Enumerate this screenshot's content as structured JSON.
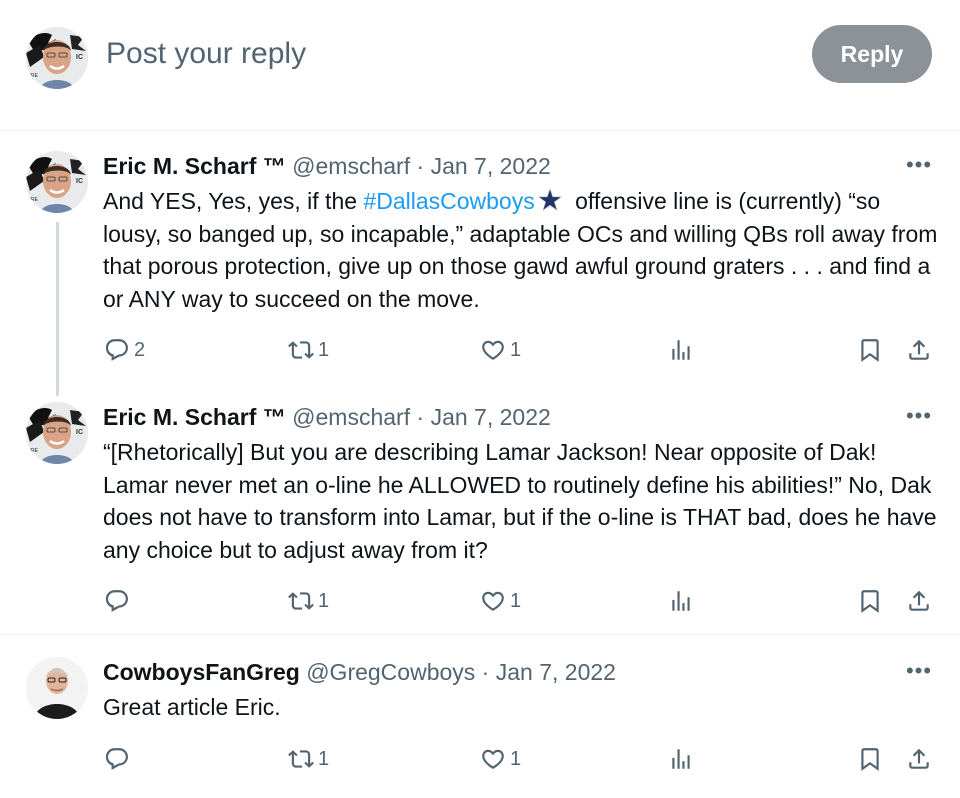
{
  "compose": {
    "placeholder": "Post your reply",
    "reply_label": "Reply"
  },
  "colors": {
    "link": "#1d9bf0",
    "muted": "#536471",
    "reply_button_disabled": "#8b9298"
  },
  "tweets": [
    {
      "name": "Eric M. Scharf ™",
      "handle": "@emscharf",
      "separator": "·",
      "date": "Jan 7, 2022",
      "text_before": "And YES, Yes, yes, if the ",
      "hashtag": "#DallasCowboys",
      "text_after": " offensive line is (currently) “so lousy, so banged up, so incapable,” adaptable OCs and willing QBs roll away from that porous protection, give up on those gawd awful ground graters . . . and find a or ANY way to succeed on the move.",
      "replies": "2",
      "reposts": "1",
      "likes": "1"
    },
    {
      "name": "Eric M. Scharf ™",
      "handle": "@emscharf",
      "separator": "·",
      "date": "Jan 7, 2022",
      "text": "“[Rhetorically] But you are describing Lamar Jackson! Near opposite of Dak! Lamar never met an o-line he ALLOWED to routinely define his abilities!” No, Dak does not have to transform into Lamar, but if the o-line is THAT bad, does he have any choice but to adjust away from it?",
      "reposts": "1",
      "likes": "1"
    },
    {
      "name": "CowboysFanGreg",
      "handle": "@GregCowboys",
      "separator": "·",
      "date": "Jan 7, 2022",
      "text": "Great article Eric.",
      "reposts": "1",
      "likes": "1"
    }
  ],
  "icons": [
    "reply-icon",
    "repost-icon",
    "like-icon",
    "views-icon",
    "bookmark-icon",
    "share-icon",
    "more-icon",
    "cowboys-star-icon"
  ]
}
